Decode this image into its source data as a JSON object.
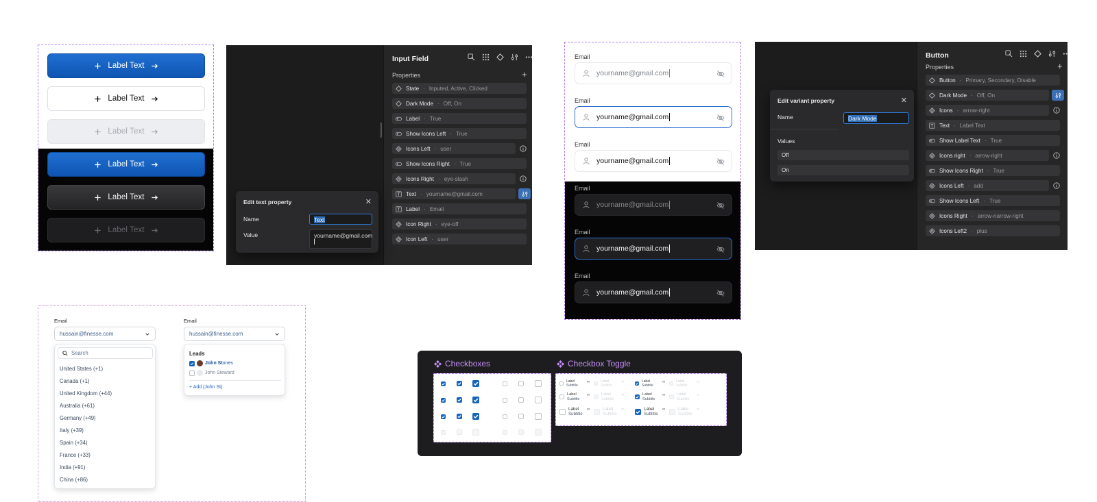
{
  "buttons_panel": {
    "label": "Label Text",
    "variants": [
      "primary",
      "secondary",
      "disabled",
      "primary-dark",
      "secondary-dark",
      "disabled-dark"
    ]
  },
  "input_field_panel": {
    "title": "Input Field",
    "properties_label": "Properties",
    "properties": [
      {
        "name": "State",
        "value": "Inputed, Active, Clicked",
        "icon": "diamond-icon"
      },
      {
        "name": "Dark Mode",
        "value": "Off, On",
        "icon": "diamond-icon"
      },
      {
        "name": "Label",
        "value": "True",
        "icon": "toggle-icon"
      },
      {
        "name": "Show Icons Left",
        "value": "True",
        "icon": "toggle-icon"
      },
      {
        "name": "Icons Left",
        "value": "user",
        "icon": "instance-icon"
      },
      {
        "name": "Show Icons Right",
        "value": "True",
        "icon": "toggle-icon"
      },
      {
        "name": "Icons Right",
        "value": "eye-slash",
        "icon": "instance-icon"
      },
      {
        "name": "Text",
        "value": "yourname@gmail.com",
        "icon": "text-icon"
      },
      {
        "name": "Label",
        "value": "Email",
        "icon": "text-icon"
      },
      {
        "name": "Icon Right",
        "value": "eye-off",
        "icon": "instance-icon"
      },
      {
        "name": "Icon Left",
        "value": "user",
        "icon": "instance-icon"
      }
    ],
    "dialog": {
      "title": "Edit text property",
      "name_label": "Name",
      "name_value": "Text",
      "value_label": "Value",
      "value_value": "yourname@gmail.com"
    }
  },
  "email_panel": {
    "label": "Email",
    "value": "yourname@gmail.com",
    "variants": [
      "light-inputed",
      "light-active",
      "light-clicked",
      "dark-inputed",
      "dark-active",
      "dark-clicked"
    ]
  },
  "button_panel": {
    "title": "Button",
    "properties_label": "Properties",
    "properties": [
      {
        "name": "Button",
        "value": "Primary, Secondary, Disable",
        "icon": "diamond-icon"
      },
      {
        "name": "Dark Mode",
        "value": "Off, On",
        "icon": "diamond-icon"
      },
      {
        "name": "Icons",
        "value": "arrow-right",
        "icon": "instance-icon"
      },
      {
        "name": "Text",
        "value": "Label Text",
        "icon": "text-icon"
      },
      {
        "name": "Show Label Text",
        "value": "True",
        "icon": "toggle-icon"
      },
      {
        "name": "Icons right",
        "value": "arrow-right",
        "icon": "instance-icon"
      },
      {
        "name": "Show Icons Right",
        "value": "True",
        "icon": "toggle-icon"
      },
      {
        "name": "Icons Left",
        "value": "add",
        "icon": "instance-icon"
      },
      {
        "name": "Show Icons Left",
        "value": "True",
        "icon": "toggle-icon"
      },
      {
        "name": "Icons Right",
        "value": "arrow-narrow-right",
        "icon": "instance-icon"
      },
      {
        "name": "Icons Left2",
        "value": "plus",
        "icon": "instance-icon"
      }
    ],
    "dialog": {
      "title": "Edit variant property",
      "name_label": "Name",
      "name_value": "Dark Mode",
      "values_label": "Values",
      "values": [
        "Off",
        "On"
      ]
    }
  },
  "country_panel": {
    "left": {
      "label": "Email",
      "value": "hussain@finesse.com",
      "search_placeholder": "Search",
      "options": [
        "United States (+1)",
        "Canada (+1)",
        "United Kingdom (+44)",
        "Australia (+61)",
        "Germany (+49)",
        "Italy (+39)",
        "Spain (+34)",
        "France (+33)",
        "India (+91)",
        "China (+86)"
      ]
    },
    "right": {
      "label": "Email",
      "value": "hussain@finesse.com",
      "group_label": "Leads",
      "contacts": [
        {
          "name_match": "John St",
          "name_rest": "ones",
          "checked": true
        },
        {
          "name_match": "John Steward",
          "name_rest": "",
          "checked": false
        }
      ],
      "add_label": "+ Add (John St)"
    }
  },
  "checkbox_panel": {
    "title_checkboxes": "Checkboxes",
    "title_toggle": "Checkbox Toggle",
    "toggle_label": "Label",
    "toggle_subtitle": "Subtitle",
    "infinity": "∞"
  },
  "colors": {
    "accent_blue": "#1565c0",
    "purple": "#c48ef5",
    "dark_bg": "#1c1c1d"
  }
}
